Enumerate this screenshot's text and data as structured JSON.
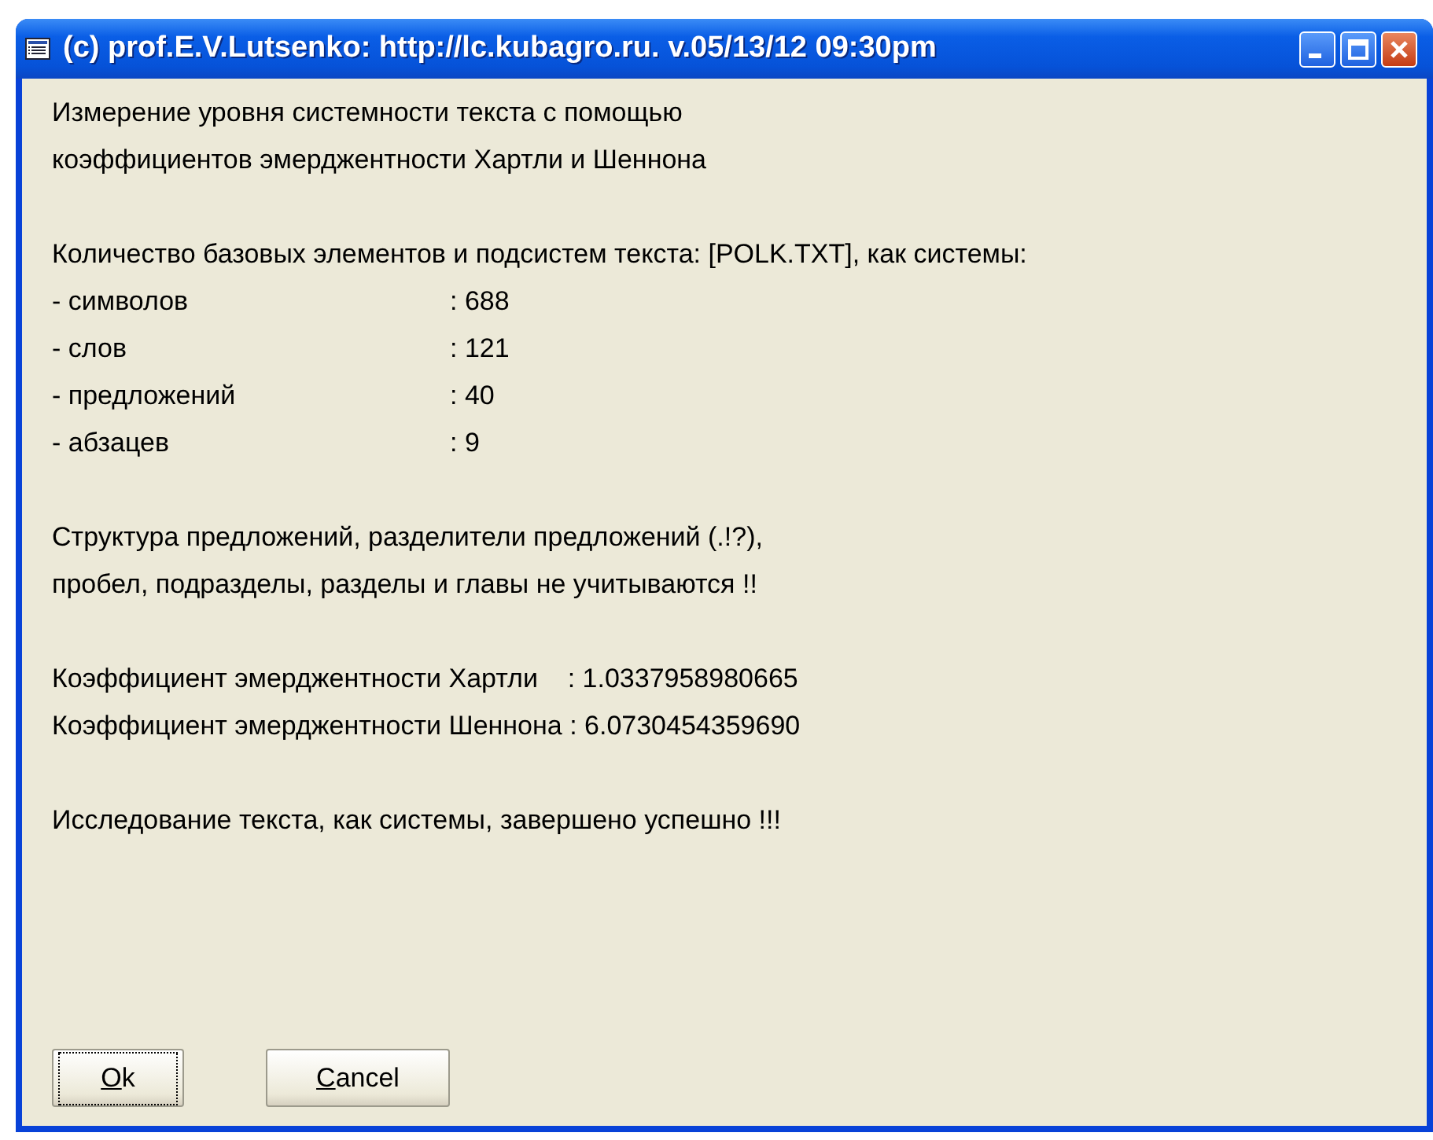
{
  "window": {
    "title": "(c) prof.E.V.Lutsenko: http://lc.kubagro.ru. v.05/13/12 09:30pm"
  },
  "paragraphs": [
    {
      "lines": [
        "Измерение уровня системности текста с помощью",
        "коэффициентов эмерджентности Хартли и Шеннона"
      ]
    },
    {
      "lines": [
        "Количество базовых элементов и подсистем текста: [POLK.TXT], как системы:"
      ],
      "stats": [
        {
          "label": "- символов",
          "value": ": 688"
        },
        {
          "label": "- слов",
          "value": ": 121"
        },
        {
          "label": "- предложений",
          "value": ": 40"
        },
        {
          "label": "- абзацев",
          "value": ": 9"
        }
      ]
    },
    {
      "lines": [
        "Структура предложений, разделители предложений (.!?),",
        "пробел, подразделы, разделы и главы не учитываются !!"
      ]
    },
    {
      "lines": [
        "Коэффициент эмерджентности Хартли    : 1.0337958980665",
        "Коэффициент эмерджентности Шеннона : 6.0730454359690"
      ]
    },
    {
      "lines": [
        "Исследование текста, как системы, завершено успешно !!!"
      ]
    }
  ],
  "buttons": [
    {
      "label": "Ok",
      "focused": true,
      "mnemonic_underlined": true
    },
    {
      "label": "Cancel",
      "focused": false,
      "mnemonic_underlined": true
    }
  ]
}
